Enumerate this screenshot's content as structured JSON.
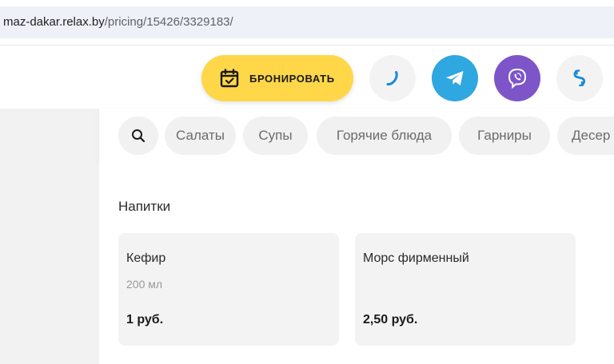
{
  "browser": {
    "url_domain": "maz-dakar.relax.by",
    "url_path": "/pricing/15426/3329183/"
  },
  "header": {
    "book_label": "БРОНИРОВАТЬ",
    "icons": [
      "calendar-check-icon",
      "phone-icon",
      "telegram-icon",
      "viber-icon",
      "link-icon"
    ],
    "colors": {
      "book": "#ffd748",
      "telegram": "#2fa7e0",
      "viber": "#7d55c9",
      "accent": "#1a8ad8"
    }
  },
  "categories": {
    "search_icon": "search-icon",
    "items": [
      {
        "label": "Салаты"
      },
      {
        "label": "Супы"
      },
      {
        "label": "Горячие блюда"
      },
      {
        "label": "Гарниры"
      },
      {
        "label": "Десер"
      }
    ]
  },
  "section": {
    "title": "Напитки",
    "items": [
      {
        "name": "Кефир",
        "volume": "200 мл",
        "price": "1 руб."
      },
      {
        "name": "Морс фирменный",
        "volume": "",
        "price": "2,50 руб."
      }
    ]
  }
}
